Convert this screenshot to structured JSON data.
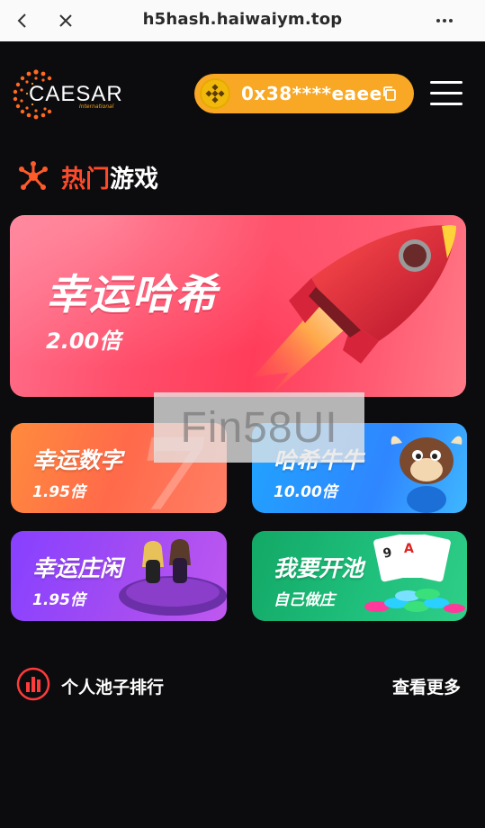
{
  "browser": {
    "url": "h5hash.haiwaiym.top"
  },
  "header": {
    "logo_text": "CAESAR",
    "logo_sub": "International",
    "wallet_address": "0x38****eaee"
  },
  "section": {
    "title_hot": "热门",
    "title_rest": "游戏"
  },
  "hero": {
    "name": "幸运哈希",
    "multiplier": "2.00倍"
  },
  "games": [
    {
      "name": "幸运数字",
      "multiplier": "1.95倍"
    },
    {
      "name": "哈希牛牛",
      "multiplier": "10.00倍"
    },
    {
      "name": "幸运庄闲",
      "multiplier": "1.95倍"
    },
    {
      "name": "我要开池",
      "multiplier": "自己做庄"
    }
  ],
  "ranking": {
    "label": "个人池子排行",
    "more": "查看更多"
  },
  "watermark": "Fin58UI",
  "colors": {
    "accent": "#f9a825",
    "hot": "#ff4a2a",
    "background": "#0c0c0f"
  }
}
